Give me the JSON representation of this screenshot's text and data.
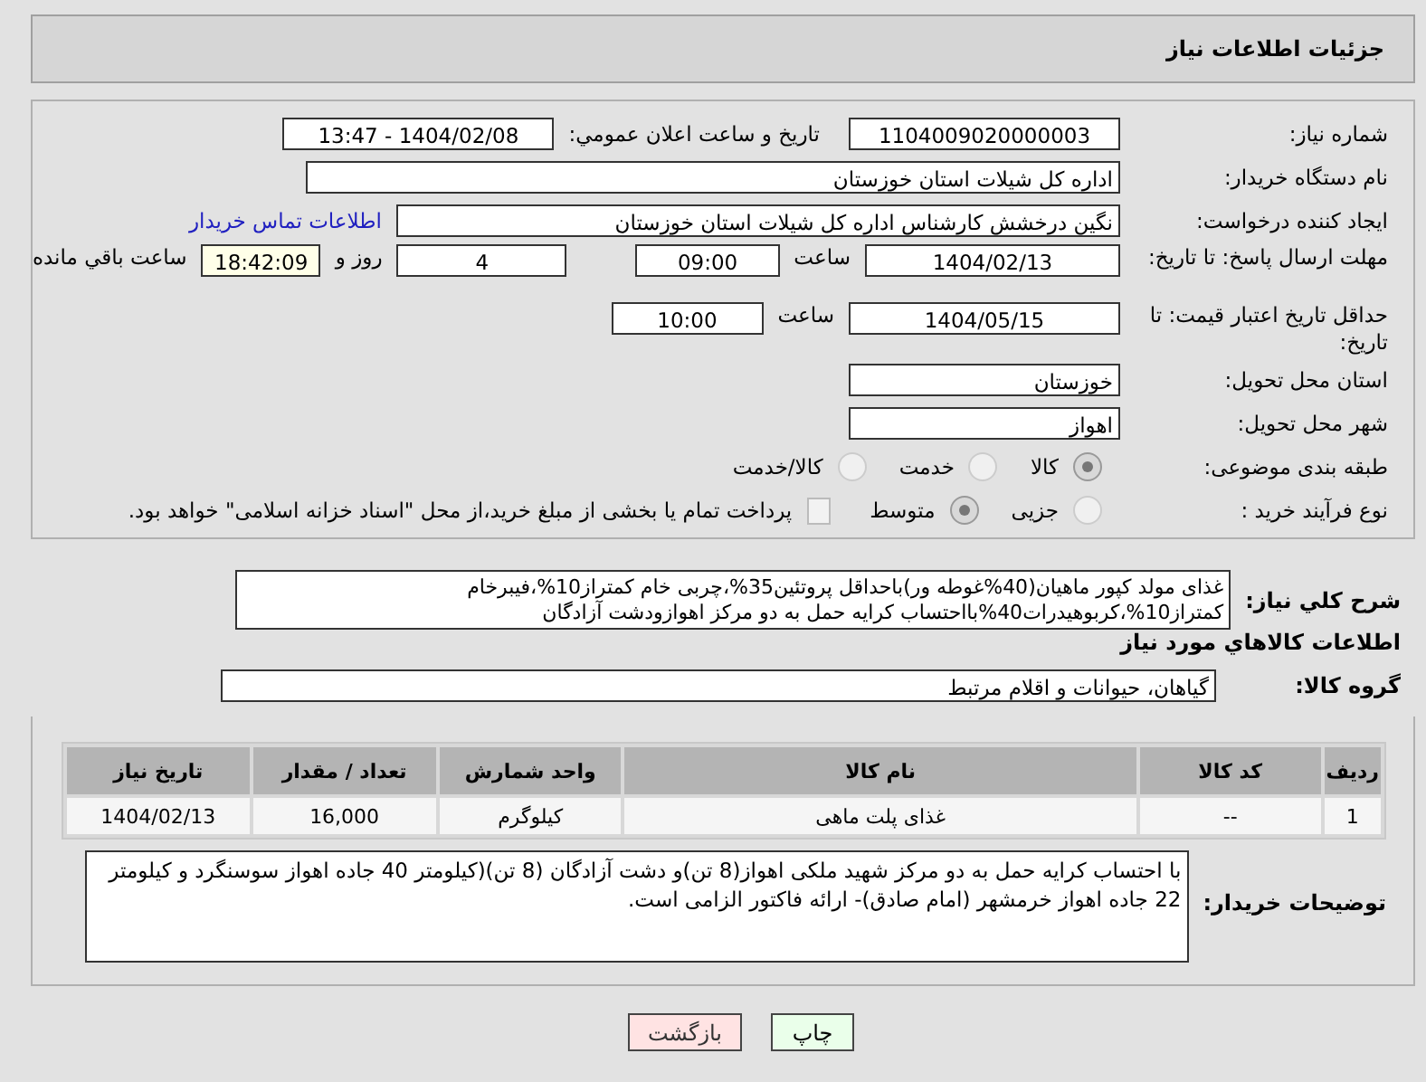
{
  "header": {
    "title": "جزئیات اطلاعات نیاز"
  },
  "need_number": {
    "label": "شماره نیاز:",
    "value": "1104009020000003"
  },
  "announce": {
    "label": "تاریخ و ساعت اعلان عمومي:",
    "value": "1404/02/08 - 13:47"
  },
  "buyer_org": {
    "label": "نام دستگاه خریدار:",
    "value": "اداره کل شیلات استان خوزستان"
  },
  "requester": {
    "label": "ایجاد کننده درخواست:",
    "value": "نگین درخشش کارشناس اداره کل شیلات استان خوزستان",
    "link": "اطلاعات تماس خریدار"
  },
  "reply_deadline": {
    "label": "مهلت ارسال پاسخ: تا تاریخ:",
    "date": "1404/02/13",
    "time_label": "ساعت",
    "time": "09:00",
    "days": "4",
    "days_label": "روز و",
    "remaining": "18:42:09",
    "remaining_label": "ساعت باقي مانده"
  },
  "price_validity": {
    "label": "حداقل تاریخ اعتبار قیمت: تا تاریخ:",
    "date": "1404/05/15",
    "time_label": "ساعت",
    "time": "10:00"
  },
  "province": {
    "label": "استان محل تحویل:",
    "value": "خوزستان"
  },
  "city": {
    "label": "شهر محل تحویل:",
    "value": "اهواز"
  },
  "category": {
    "label": "طبقه بندی موضوعی:",
    "options": [
      {
        "label": "کالا",
        "selected": true
      },
      {
        "label": "خدمت",
        "selected": false
      },
      {
        "label": "کالا/خدمت",
        "selected": false
      }
    ]
  },
  "process": {
    "label": "نوع فرآیند خرید :",
    "options": [
      {
        "label": "جزیی",
        "selected": false
      },
      {
        "label": "متوسط",
        "selected": true
      }
    ],
    "treasury": {
      "checked": false,
      "text": "پرداخت تمام یا بخشی از مبلغ خرید،از محل \"اسناد خزانه اسلامی\" خواهد بود."
    }
  },
  "description": {
    "label": "شرح کلي نیاز:",
    "text": "غذای مولد کپور ماهیان(40%غوطه ور)باحداقل پروتئین35%،چربی خام کمتراز10%،فیبرخام کمتراز10%،کربوهیدرات40%بااحتساب کرایه حمل به دو مرکز اهوازودشت آزادگان"
  },
  "goods_heading": "اطلاعات کالاهاي مورد نیاز",
  "goods_group": {
    "label": "گروه کالا:",
    "value": "گیاهان، حیوانات و اقلام مرتبط"
  },
  "table": {
    "columns": [
      "ردیف",
      "کد کالا",
      "نام کالا",
      "واحد شمارش",
      "تعداد / مقدار",
      "تاریخ نیاز"
    ],
    "rows": [
      [
        "1",
        "--",
        "غذای پلت ماهی",
        "کیلوگرم",
        "16,000",
        "1404/02/13"
      ]
    ]
  },
  "buyer_notes": {
    "label": "توضیحات خریدار:",
    "text": "با احتساب کرایه حمل به دو مرکز شهید ملکی اهواز(8 تن)و دشت آزادگان (8 تن)(کیلومتر 40 جاده اهواز سوسنگرد و کیلومتر 22 جاده اهواز خرمشهر (امام صادق)- ارائه فاکتور الزامی است."
  },
  "buttons": [
    {
      "label": "چاپ",
      "kind": "print"
    },
    {
      "label": "بازگشت",
      "kind": "back"
    }
  ]
}
